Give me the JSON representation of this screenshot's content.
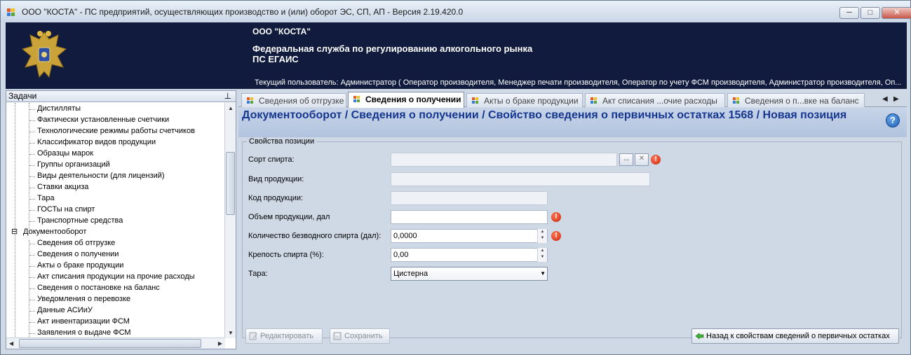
{
  "window": {
    "title": "ООО \"КОСТА\" - ПС предприятий, осуществляющих производство и (или) оборот ЭС, СП, АП - Версия 2.19.420.0",
    "controls": {
      "minimize": "─",
      "maximize": "□",
      "close": "✕"
    }
  },
  "banner": {
    "org": "ООО \"КОСТА\"",
    "agency_line1": "Федеральная служба по регулированию алкогольного рынка",
    "agency_line2": "ПС ЕГАИС",
    "current_user": "Текущий пользователь: Администратор ( Оператор производителя, Менеджер печати производителя, Оператор по учету ФСМ производителя, Администратор производителя, Оп..."
  },
  "tasks_panel": {
    "title": "Задачи",
    "pin": "⊥",
    "items": [
      "Дистилляты",
      "Фактически установленные счетчики",
      "Технологические режимы работы счетчиков",
      "Классификатор видов продукции",
      "Образцы марок",
      "Группы организаций",
      "Виды деятельности (для лицензий)",
      "Ставки акциза",
      "Тара",
      "ГОСТы на спирт",
      "Транспортные средства"
    ],
    "group": {
      "toggle": "⊟",
      "label": "Документооборот"
    },
    "group_items": [
      "Сведения об отгрузке",
      "Сведения о получении",
      "Акты о браке продукции",
      "Акт списания продукции на прочие расходы",
      "Сведения о постановке на баланс",
      "Уведомления о перевозке",
      "Данные АСИиУ",
      "Акт инвентаризации ФСМ",
      "Заявления о выдаче ФСМ"
    ]
  },
  "tabs": [
    {
      "label": "Сведения об отгрузке",
      "active": false
    },
    {
      "label": "Сведения о получении",
      "active": true
    },
    {
      "label": "Акты о браке продукции",
      "active": false
    },
    {
      "label": "Акт списания ...очие расходы",
      "active": false
    },
    {
      "label": "Сведения о п...вке на баланс",
      "active": false
    }
  ],
  "tab_nav": {
    "prev": "◀",
    "next": "▶"
  },
  "heading": "Документооборот  / Сведения о получении / Свойство сведения о первичных остатках 1568 / Новая позиция",
  "help_label": "?",
  "form": {
    "group_title": "Свойства позиции",
    "fields": [
      {
        "label": "Сорт спирта:",
        "value": "",
        "error": "!"
      },
      {
        "label": "Вид продукции:",
        "value": ""
      },
      {
        "label": "Код продукции:",
        "value": ""
      },
      {
        "label": "Объем продукции, дал",
        "value": "",
        "error": "!"
      },
      {
        "label": "Количество безводного спирта (дал):",
        "value": "0,0000",
        "error": "!"
      },
      {
        "label": "Крепость спирта (%):",
        "value": "0,00"
      },
      {
        "label": "Тара:",
        "value": "Цистерна"
      }
    ],
    "browse_label": "...",
    "clear_label": "✕"
  },
  "buttons": {
    "edit": "Редактировать",
    "save": "Сохранить",
    "back": "Назад к свойствам сведений о первичных остатках"
  },
  "colors": {
    "banner_bg": "#101b3d",
    "heading_text": "#15378f",
    "error": "#c9240b"
  }
}
